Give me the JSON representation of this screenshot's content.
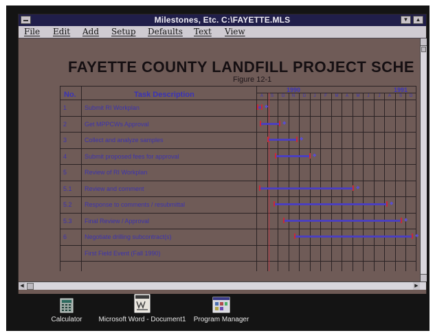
{
  "window": {
    "title": "Milestones, Etc. C:\\FAYETTE.MLS"
  },
  "menu": [
    "File",
    "Edit",
    "Add",
    "Setup",
    "Defaults",
    "Text",
    "View"
  ],
  "document": {
    "title": "FAYETTE COUNTY LANDFILL PROJECT SCHE",
    "subtitle": "Figure 12-1",
    "columns": {
      "no": "No.",
      "task": "Task Description"
    },
    "years": [
      "1990",
      "1991"
    ],
    "tasks": [
      {
        "no": "1",
        "label": "Submit RI Workplan"
      },
      {
        "no": "2",
        "label": "Get MPPCWs Approval"
      },
      {
        "no": "3",
        "label": "Collect and analyze samples"
      },
      {
        "no": "4",
        "label": "Submit proposed fees for approval"
      },
      {
        "no": "5",
        "label": "Review of RI Workplan"
      },
      {
        "no": "5.1",
        "label": "Review and comment"
      },
      {
        "no": "5.2",
        "label": "Response to comments / resubmittal"
      },
      {
        "no": "5.3",
        "label": "Final Review / Approval"
      },
      {
        "no": "6",
        "label": "Negotiate drilling subcontract(s)"
      },
      {
        "no": "",
        "label": "First Field Event (Fall 1990)"
      }
    ]
  },
  "taskbar": {
    "items": [
      {
        "label": "Calculator",
        "icon": "calculator-icon"
      },
      {
        "label": "Microsoft Word - Document1",
        "icon": "word-document-icon"
      },
      {
        "label": "Program Manager",
        "icon": "program-manager-icon"
      }
    ]
  }
}
